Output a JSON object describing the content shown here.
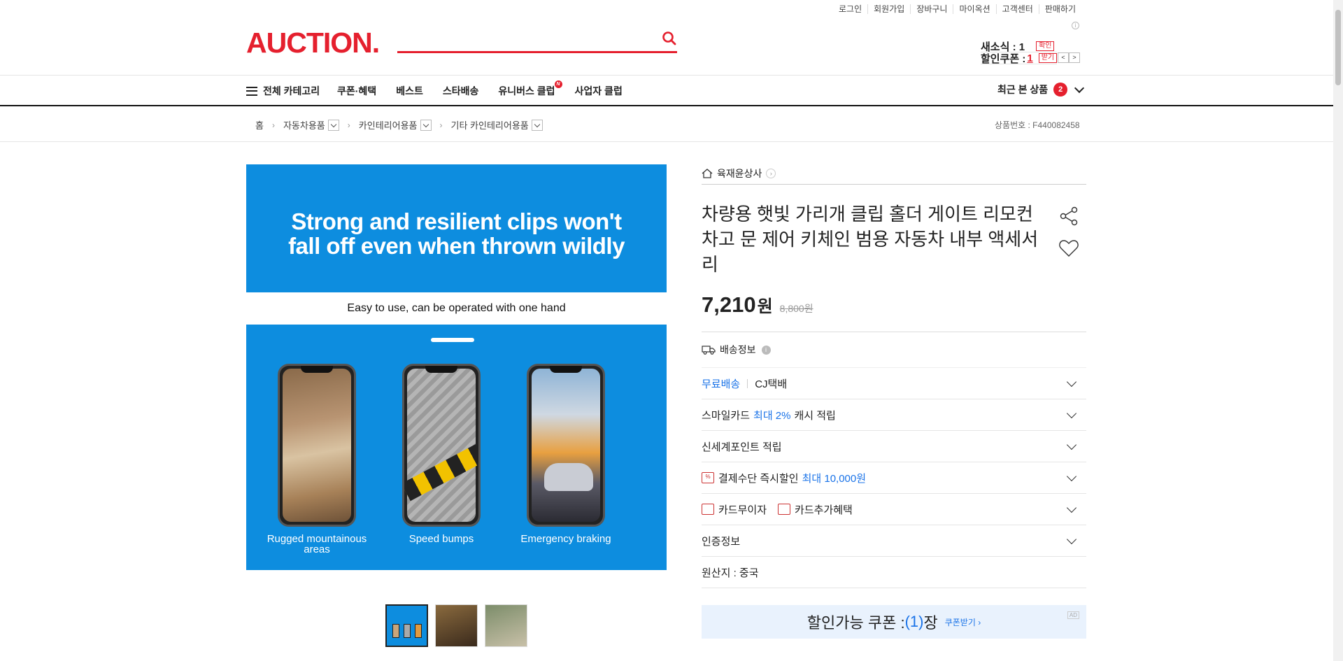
{
  "util_links": [
    "로그인",
    "회원가입",
    "장바구니",
    "마이옥션",
    "고객센터",
    "판매하기"
  ],
  "logo": "AUCTION.",
  "user_panel": {
    "seller_label": "새소식 : 1",
    "seller_btn": "확인",
    "coupon_label": "할인쿠폰 : ",
    "coupon_count": "1",
    "coupon_btn": "받기"
  },
  "nav": {
    "all_categories": "전체 카테고리",
    "items": [
      "쿠폰·혜택",
      "베스트",
      "스타배송",
      "유니버스 클럽",
      "사업자 클럽"
    ],
    "new_badge": "N",
    "recent_label": "최근 본 상품",
    "recent_count": "2"
  },
  "breadcrumb": {
    "home": "홈",
    "levels": [
      "자동차용품",
      "카인테리어용품",
      "기타 카인테리어용품"
    ],
    "product_no": "상품번호 : F440082458"
  },
  "hero": {
    "headline_1": "Strong and resilient clips won't",
    "headline_2": "fall off even when thrown wildly",
    "subtitle": "Easy to use, can be operated with one hand",
    "captions": [
      "Rugged mountainous areas",
      "Speed bumps",
      "Emergency braking"
    ]
  },
  "product": {
    "seller": "육재윤상사",
    "title": "차량용 햇빛 가리개 클립 홀더 게이트 리모컨 차고 문 제어 키체인 범용 자동차 내부 액세서리",
    "price": "7,210",
    "won": "원",
    "original_price": "8,800원"
  },
  "info_rows": {
    "shipping_title": "배송정보",
    "free_shipping": "무료배송",
    "carrier": "CJ택배",
    "smile_pre": "스마일카드 ",
    "smile_blue": "최대 2%",
    "smile_post": " 캐시 적립",
    "shinsegae": "신세계포인트 적립",
    "pay_pre": "결제수단 즉시할인 ",
    "pay_blue": "최대 10,000원",
    "card_free": "카드무이자",
    "card_extra": "카드추가혜택",
    "cert": "인증정보",
    "origin": "원산지 : 중국"
  },
  "coupon": {
    "label": "할인가능 쿠폰 : ",
    "count": "(1)",
    "suffix": "장",
    "get": "쿠폰받기 ›",
    "ad": "AD"
  },
  "colors": {
    "brand": "#e5202e",
    "blue": "#1a73e8",
    "hero_bg": "#0d8ddf"
  }
}
